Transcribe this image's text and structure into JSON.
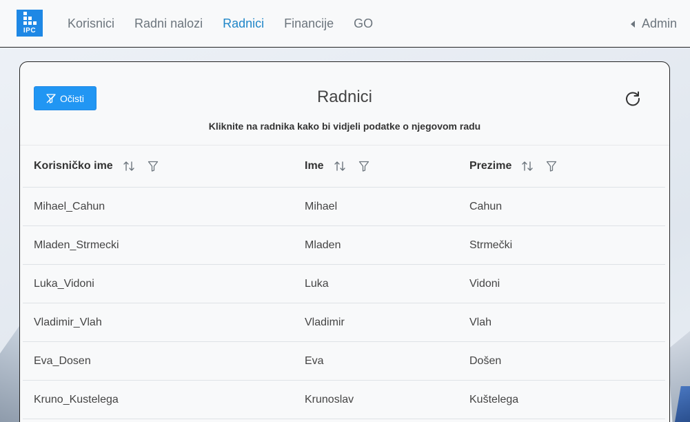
{
  "nav": {
    "logo_text": "IPC",
    "links": [
      {
        "label": "Korisnici",
        "active": false
      },
      {
        "label": "Radni nalozi",
        "active": false
      },
      {
        "label": "Radnici",
        "active": true
      },
      {
        "label": "Financije",
        "active": false
      },
      {
        "label": "GO",
        "active": false
      }
    ],
    "user": "Admin"
  },
  "card": {
    "clear_button": "Očisti",
    "title": "Radnici",
    "subtitle": "Kliknite na radnika kako bi vidjeli podatke o njegovom radu"
  },
  "table": {
    "columns": [
      "Korisničko ime",
      "Ime",
      "Prezime"
    ],
    "rows": [
      [
        "Mihael_Cahun",
        "Mihael",
        "Cahun"
      ],
      [
        "Mladen_Strmecki",
        "Mladen",
        "Strmečki"
      ],
      [
        "Luka_Vidoni",
        "Luka",
        "Vidoni"
      ],
      [
        "Vladimir_Vlah",
        "Vladimir",
        "Vlah"
      ],
      [
        "Eva_Dosen",
        "Eva",
        "Došen"
      ],
      [
        "Kruno_Kustelega",
        "Krunoslav",
        "Kuštelega"
      ]
    ]
  },
  "colors": {
    "accent": "#2196f3",
    "active_nav": "#1f86c8"
  },
  "icons": [
    "filter-clear-icon",
    "refresh-icon",
    "sort-icon",
    "filter-icon",
    "caret-left-icon",
    "logo-icon"
  ]
}
